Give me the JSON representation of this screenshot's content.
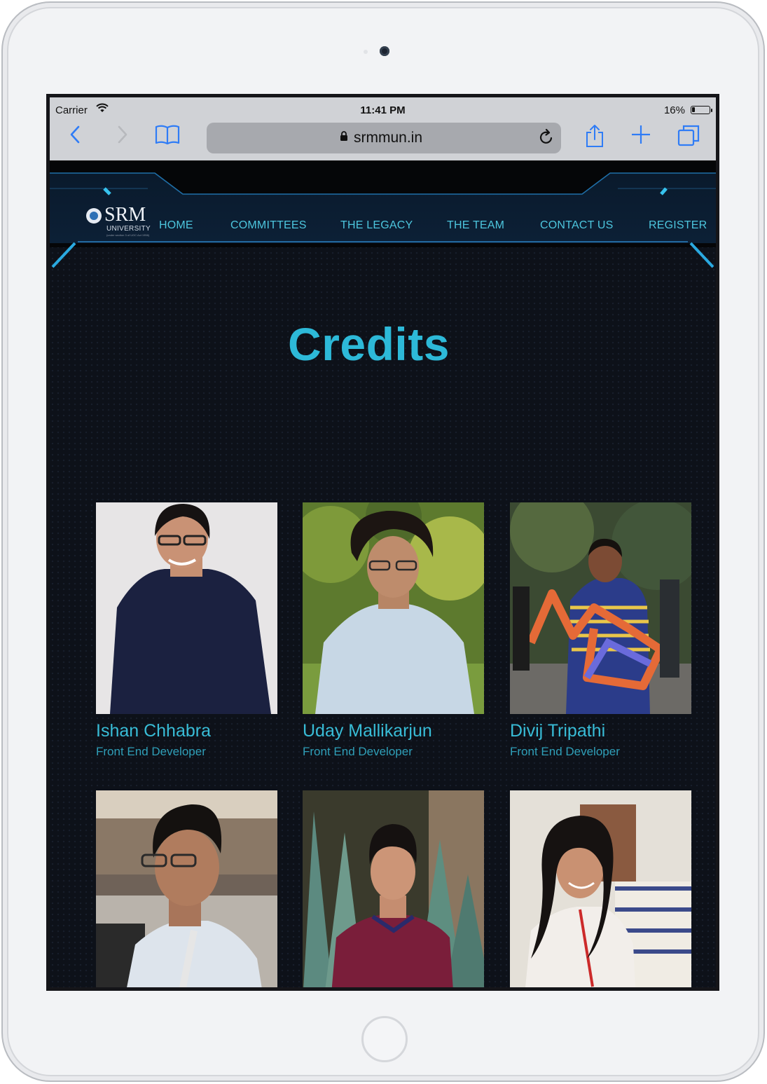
{
  "status_bar": {
    "carrier": "Carrier",
    "time": "11:41 PM",
    "battery": "16%",
    "battery_level": 0.16
  },
  "browser": {
    "url": "srmmun.in",
    "icons": [
      "back-icon",
      "forward-icon",
      "bookmarks-icon",
      "lock-icon",
      "reload-icon",
      "share-icon",
      "new-tab-icon",
      "tabs-icon"
    ]
  },
  "site": {
    "logo": {
      "name": "SRM",
      "subtitle": "UNIVERSITY",
      "note": "(under section 3 of UGC Act 1956)"
    },
    "nav": [
      {
        "label": "HOME"
      },
      {
        "label": "COMMITTEES"
      },
      {
        "label": "THE LEGACY"
      },
      {
        "label": "THE TEAM"
      },
      {
        "label": "CONTACT US"
      },
      {
        "label": "REGISTER"
      }
    ],
    "title": "Credits",
    "team": [
      {
        "name": "Ishan Chhabra",
        "role": "Front End Developer"
      },
      {
        "name": "Uday Mallikarjun",
        "role": "Front End Developer"
      },
      {
        "name": "Divij Tripathi",
        "role": "Front End Developer"
      },
      {
        "name": "",
        "role": ""
      },
      {
        "name": "",
        "role": ""
      },
      {
        "name": "",
        "role": ""
      }
    ]
  },
  "colors": {
    "accent": "#2db9d8",
    "background": "#0d1119",
    "safari_blue": "#2f7cf6"
  }
}
